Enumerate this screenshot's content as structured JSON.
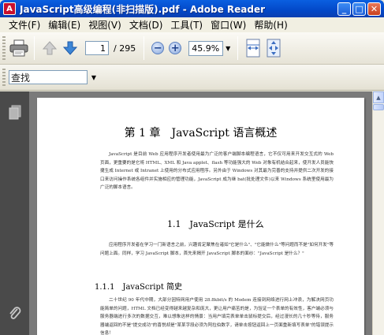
{
  "window": {
    "title": "JavaScript高级编程(非扫描版).pdf - Adobe Reader",
    "app_icon": "adobe-reader-icon",
    "buttons": {
      "minimize": "_",
      "maximize": "□",
      "close": "✕"
    }
  },
  "menu": {
    "items": [
      "文件(F)",
      "编辑(E)",
      "视图(V)",
      "文档(D)",
      "工具(T)",
      "窗口(W)",
      "帮助(H)"
    ]
  },
  "toolbar": {
    "current_page": "1",
    "total_pages": "/ 295",
    "zoom": "45.9%",
    "icons": [
      "printer-icon",
      "previous-page-icon",
      "next-page-icon",
      "zoom-out-icon",
      "zoom-in-icon",
      "fit-width-icon",
      "fit-page-icon"
    ]
  },
  "search": {
    "placeholder": "查找",
    "value": "查找"
  },
  "nav_panel": {
    "icons": [
      "pages-panel-icon",
      "attachments-icon"
    ]
  },
  "document": {
    "chapter_title": "第 1 章　JavaScript 语言概述",
    "intro": "JavaScript 是目前 Web 应用程序开发者使用最为广泛的客户端脚本编程语言，它不仅可用来开发交互式的 Web 页面，更重要的是它将 HTML、XML 和 Java applet、flash 等功能强大的 Web 对象有机结合起来，使开发人员能快捷生成 Internet 或 Intranet 上使用的分布式应用程序。另外由于 Windows 对其最为完善的支持并提供二次开发的接口来访问操作系统各组件并实施相应的管理功能，JavaScript 成为继 bat(批处理文件)以来 Windows 系统里使用最为广泛的脚本语言。",
    "section_1_1": "1.1　JavaScript 是什么",
    "section_1_1_text": "应用程序开发者在学习一门新语言之前，兴趣肯定聚焦在诸如\"它是什么\"、\"它能做什么\"等问题而不是\"如何开发\"等问题上面。同样，学习 JavaScript 脚本，首先来揭开 JavaScript 脚本的面纱：\"JavaScript 是什么？\"",
    "section_1_1_1": "1.1.1　JavaScript 简史",
    "section_1_1_1_text": "二十世纪 90 年代中期，大部分因特网用户使用 28.8kbit/s 的 Modem 连接到网络进行网上冲浪，为解决网页功能简单的问题，HTML 文档已经变得越来越复杂和庞大，更让用户痛苦的是，为验证一个表单的有效性，客户端必须与服务器端进行多次的数据交互，难以想象这样的情景：当用户填完表单单击鼠标提交后，经过漫长的几十秒等待，服务器端返回的不是\"提交成功\"的喜悦却是\"某某字段必须为阿拉伯数字，请单击按钮返回上一页面重新填写表单\"的错误提示信息！"
  }
}
